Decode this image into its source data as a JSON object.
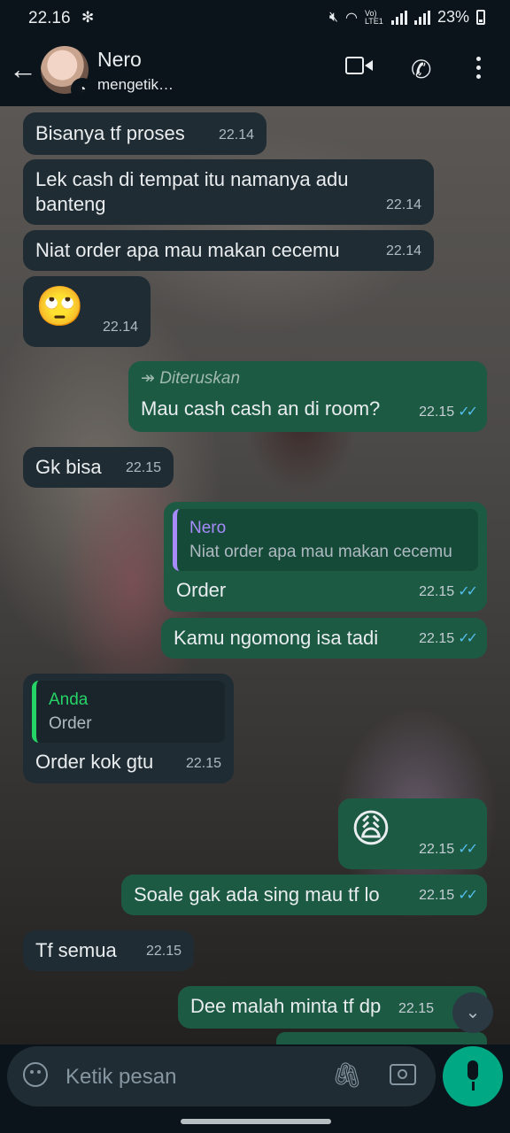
{
  "status_bar": {
    "time": "22.16",
    "lte": "Vo) LTE1",
    "battery": "23%"
  },
  "header": {
    "name": "Nero",
    "status": "mengetik…",
    "back_icon": "arrow-left-icon",
    "video_icon": "video-camera-icon",
    "call_icon": "phone-icon",
    "menu_icon": "more-vertical-icon"
  },
  "messages": [
    {
      "dir": "in",
      "text": "Bisanya tf proses",
      "time": "22.14"
    },
    {
      "dir": "in",
      "text": "Lek cash di tempat itu namanya adu banteng",
      "time": "22.14"
    },
    {
      "dir": "in",
      "text": "Niat order apa mau makan cecemu",
      "time": "22.14"
    },
    {
      "dir": "in",
      "text": "🙄",
      "time": "22.14"
    },
    {
      "dir": "out",
      "forwarded": "Diteruskan",
      "text": "Mau cash cash an di room?",
      "time": "22.15"
    },
    {
      "dir": "in",
      "text": "Gk bisa",
      "time": "22.15"
    },
    {
      "dir": "out",
      "quote_name": "Nero",
      "quote_text": "Niat order apa mau makan cecemu",
      "text": "Order",
      "time": "22.15"
    },
    {
      "dir": "out",
      "text": "Kamu ngomong isa tadi",
      "time": "22.15"
    },
    {
      "dir": "in",
      "quote_name": "Anda",
      "quote_text": "Order",
      "text": "Order kok gtu",
      "time": "22.15"
    },
    {
      "dir": "out",
      "text": "😩",
      "time": "22.15"
    },
    {
      "dir": "out",
      "text": "Soale gak ada sing mau tf lo",
      "time": "22.15"
    },
    {
      "dir": "in",
      "text": "Tf semua",
      "time": "22.15"
    },
    {
      "dir": "out",
      "text": "Dee malah minta tf dp",
      "time": "22.15"
    }
  ],
  "input": {
    "placeholder": "Ketik pesan"
  },
  "colors": {
    "incoming": "#202c33",
    "outgoing": "#1c5a43",
    "accent": "#00a884",
    "read_ticks": "#53bdeb"
  }
}
